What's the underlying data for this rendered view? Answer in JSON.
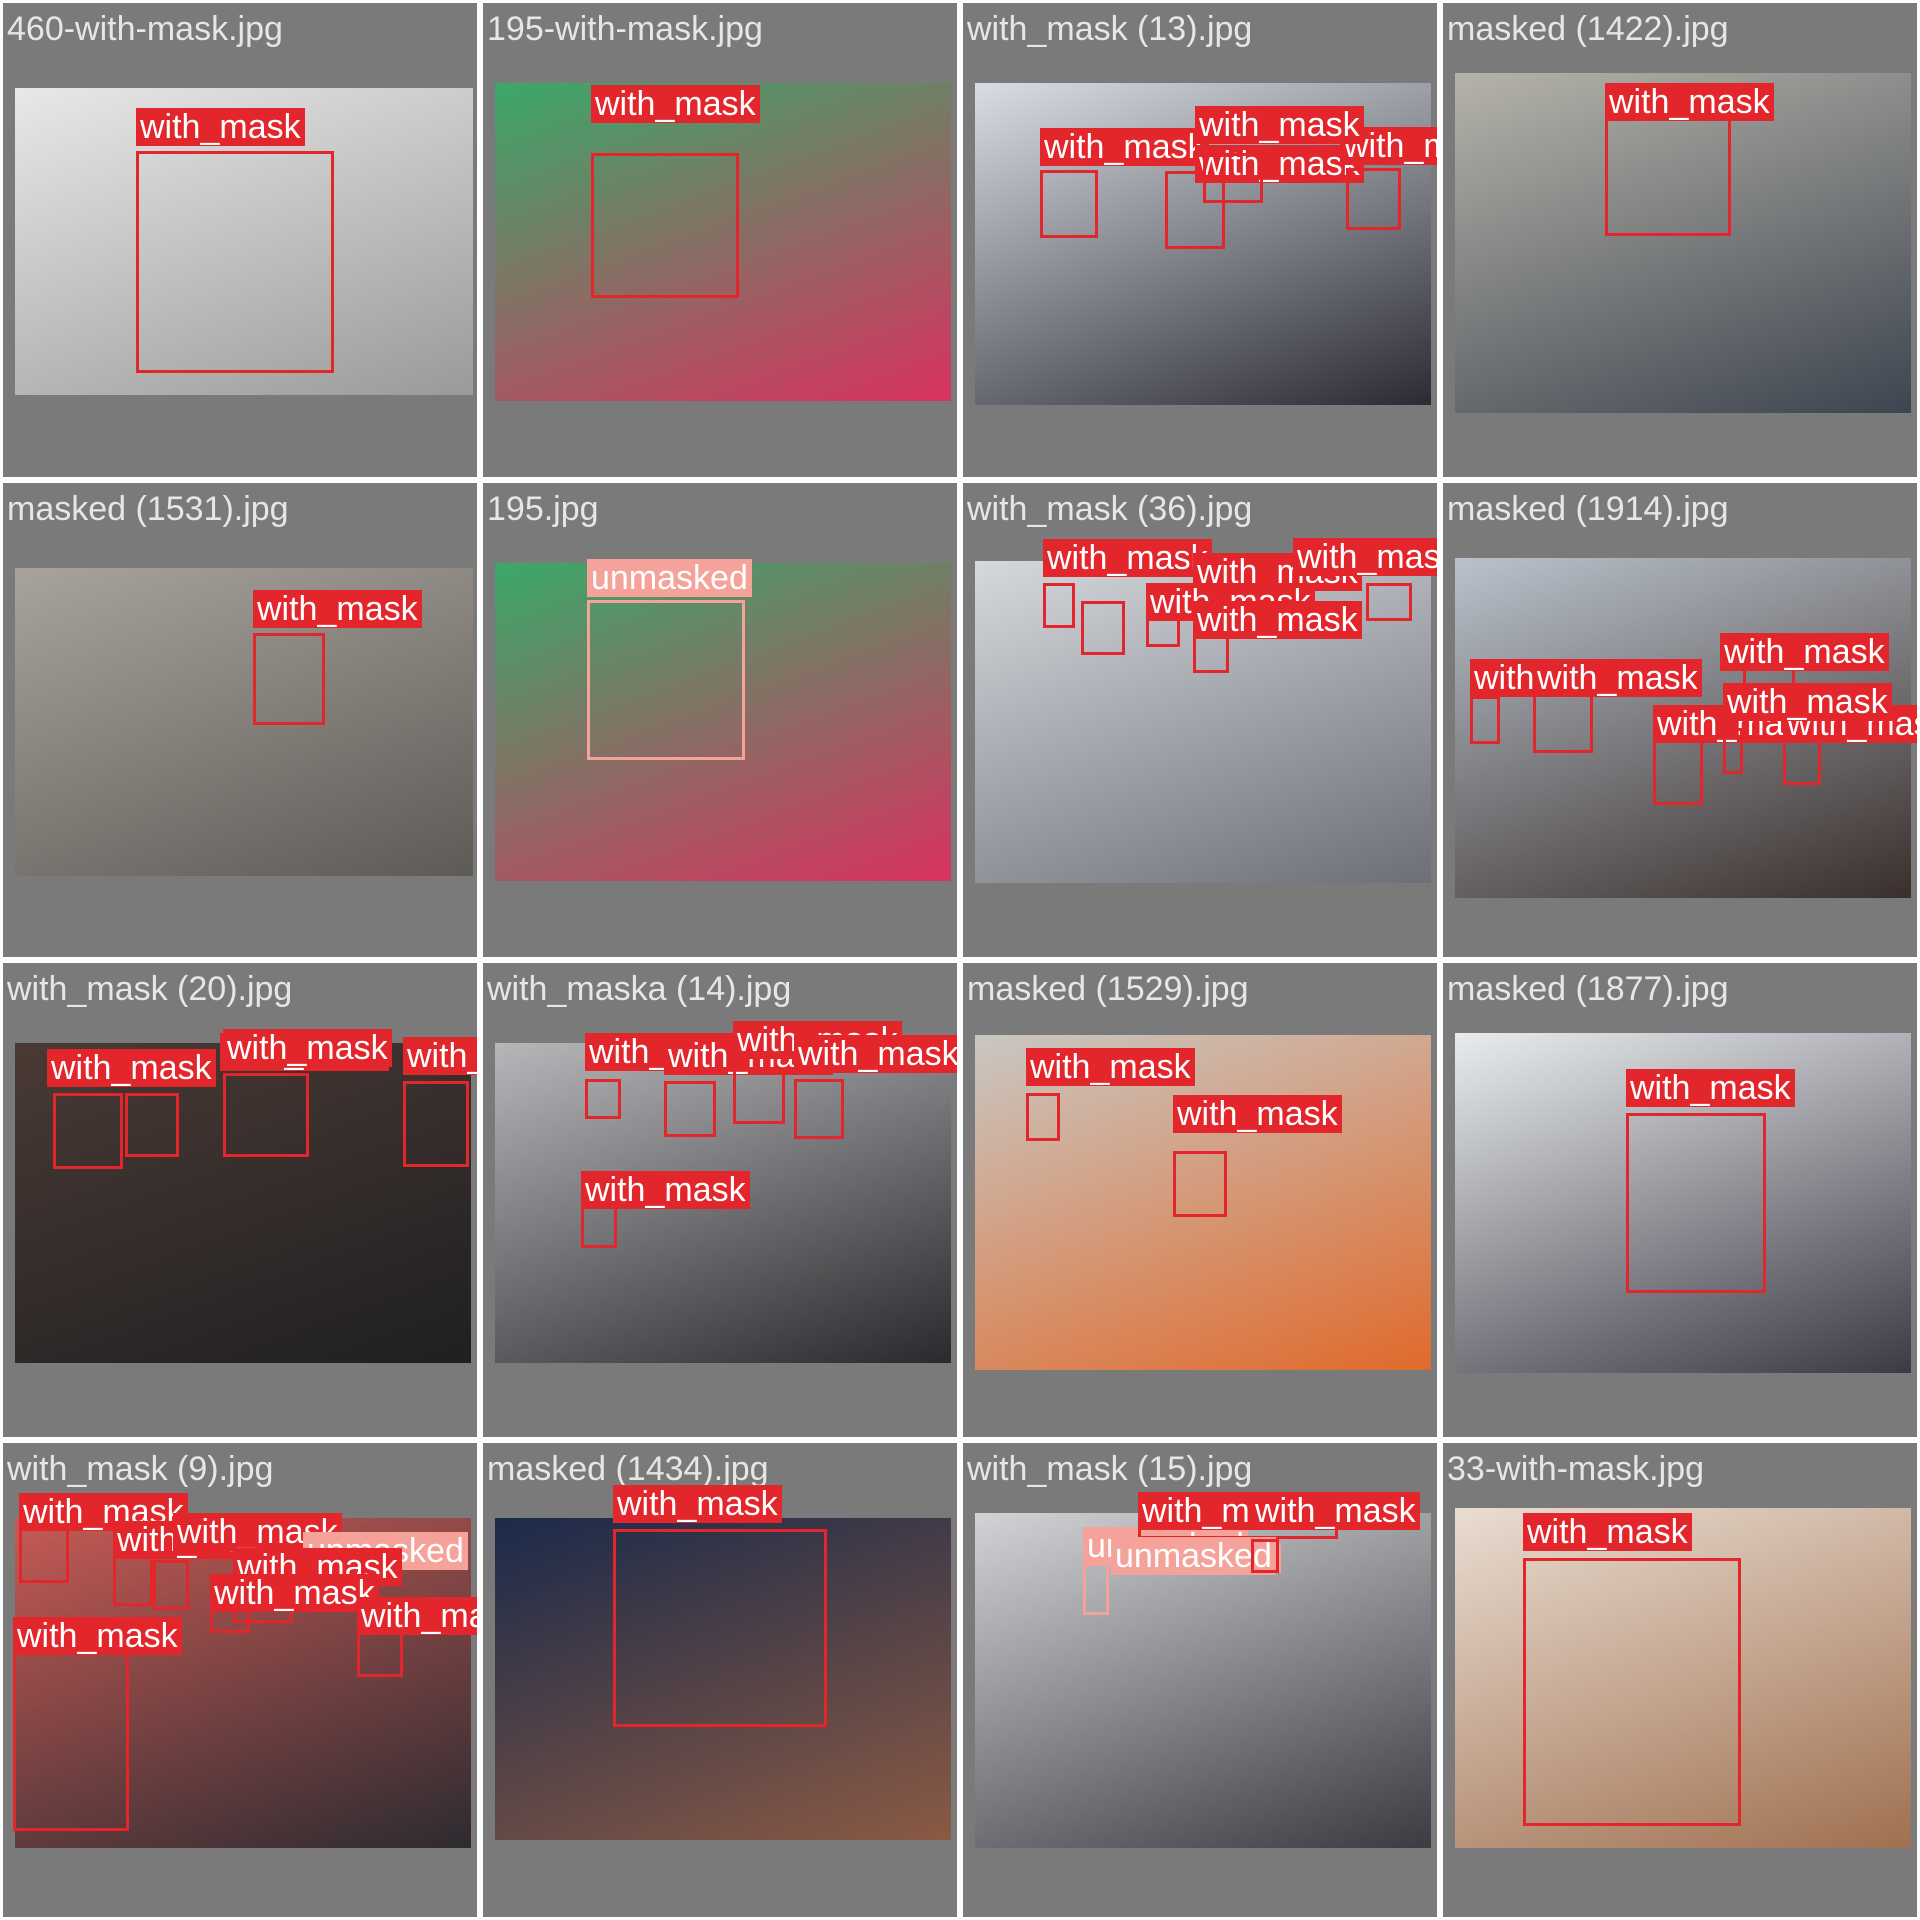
{
  "colors": {
    "cell_background": "#7a7a7a",
    "grid_background": "#ffffff",
    "filename_text": "#e6e6e6",
    "with_mask": "#e3262b",
    "unmasked": "#f4a29a"
  },
  "cells": [
    {
      "filename": "460-with-mask.jpg",
      "photo_tone": [
        "#e8e8e8",
        "#9a9a9a"
      ],
      "detections": [
        {
          "label": "with_mask"
        }
      ]
    },
    {
      "filename": "195-with-mask.jpg",
      "photo_tone": [
        "#3aa86a",
        "#d8325e"
      ],
      "detections": [
        {
          "label": "with_mask"
        }
      ]
    },
    {
      "filename": "with_mask (13).jpg",
      "photo_tone": [
        "#d9dde4",
        "#2b2b33"
      ],
      "detections": [
        {
          "label": "with_mask"
        },
        {
          "label": "with_mask"
        },
        {
          "label": "with_mask"
        },
        {
          "label": "with_mask"
        }
      ]
    },
    {
      "filename": "masked (1422).jpg",
      "photo_tone": [
        "#b5b3aa",
        "#3e4550"
      ],
      "detections": [
        {
          "label": "with_mask"
        }
      ]
    },
    {
      "filename": "masked (1531).jpg",
      "photo_tone": [
        "#a8a39c",
        "#5e5a56"
      ],
      "detections": [
        {
          "label": "with_mask"
        }
      ]
    },
    {
      "filename": "195.jpg",
      "photo_tone": [
        "#3aa86a",
        "#d8325e"
      ],
      "detections": [
        {
          "label": "unmasked"
        }
      ]
    },
    {
      "filename": "with_mask (36).jpg",
      "photo_tone": [
        "#d5d8dc",
        "#6c6f78"
      ],
      "detections": [
        {
          "label": "with_mask"
        },
        {
          "label": "with_mask"
        },
        {
          "label": "with_mask"
        },
        {
          "label": "with_mask"
        },
        {
          "label": "with_mask"
        }
      ]
    },
    {
      "filename": "masked (1914).jpg",
      "photo_tone": [
        "#b9c2cc",
        "#3a2f2c"
      ],
      "detections": [
        {
          "label": "with_mask"
        },
        {
          "label": "with_mask"
        },
        {
          "label": "with_mask"
        },
        {
          "label": "with_mask"
        },
        {
          "label": "with_mask"
        },
        {
          "label": "with_mask"
        }
      ]
    },
    {
      "filename": "with_mask (20).jpg",
      "photo_tone": [
        "#4a3a34",
        "#1f1f22"
      ],
      "detections": [
        {
          "label": "with_mask"
        },
        {
          "label": "with_mask"
        },
        {
          "label": "with_mask"
        },
        {
          "label": "with_mask"
        }
      ]
    },
    {
      "filename": "with_maska (14).jpg",
      "photo_tone": [
        "#b7b7ba",
        "#2a2a2d"
      ],
      "detections": [
        {
          "label": "with_mask"
        },
        {
          "label": "with_mask"
        },
        {
          "label": "with_mask"
        },
        {
          "label": "with_mask"
        },
        {
          "label": "with_mask"
        }
      ]
    },
    {
      "filename": "masked (1529).jpg",
      "photo_tone": [
        "#c9c7c3",
        "#e06a2c"
      ],
      "detections": [
        {
          "label": "with_mask"
        },
        {
          "label": "with_mask"
        }
      ]
    },
    {
      "filename": "masked (1877).jpg",
      "photo_tone": [
        "#e9ecef",
        "#3b3b44"
      ],
      "detections": [
        {
          "label": "with_mask"
        }
      ]
    },
    {
      "filename": "with_mask (9).jpg",
      "photo_tone": [
        "#c65a55",
        "#2d2b30"
      ],
      "detections": [
        {
          "label": "with_mask"
        },
        {
          "label": "with_mask"
        },
        {
          "label": "with_mask"
        },
        {
          "label": "unmasked"
        },
        {
          "label": "with_mask"
        },
        {
          "label": "with_mask"
        },
        {
          "label": "with_mask"
        },
        {
          "label": "with_mask"
        }
      ]
    },
    {
      "filename": "masked (1434).jpg",
      "photo_tone": [
        "#1b2a4a",
        "#8a5a44"
      ],
      "detections": [
        {
          "label": "with_mask"
        }
      ]
    },
    {
      "filename": "with_mask (15).jpg",
      "photo_tone": [
        "#d2d3d6",
        "#3a3c42"
      ],
      "detections": [
        {
          "label": "unmasked"
        },
        {
          "label": "with_mask"
        },
        {
          "label": "unmasked"
        },
        {
          "label": "with_mask"
        }
      ]
    },
    {
      "filename": "33-with-mask.jpg",
      "photo_tone": [
        "#e9ddd2",
        "#a07050"
      ],
      "detections": [
        {
          "label": "with_mask"
        }
      ]
    }
  ]
}
